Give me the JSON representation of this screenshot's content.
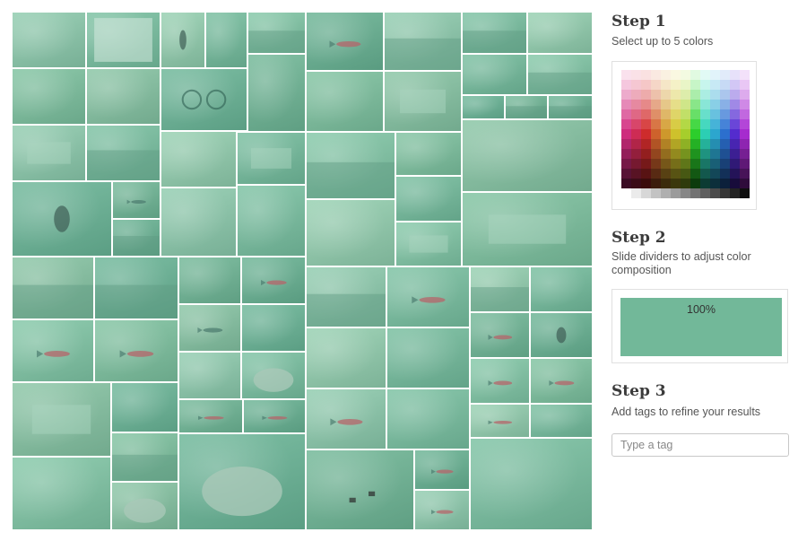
{
  "colors": {
    "water": [
      "#7ec3a4",
      "#86c9a9",
      "#6fb89a",
      "#92cdb0",
      "#79bfa0",
      "#8bc6a6",
      "#6db596",
      "#98d1b2",
      "#82c4a2",
      "#74b999"
    ],
    "selected_color": "#72b899"
  },
  "steps": [
    {
      "title": "Step 1",
      "description": "Select up to 5 colors"
    },
    {
      "title": "Step 2",
      "description": "Slide dividers to adjust color composition"
    },
    {
      "title": "Step 3",
      "description": "Add tags to refine your results"
    }
  ],
  "composition": {
    "percent_label": "100%"
  },
  "tag_input": {
    "placeholder": "Type a tag",
    "value": ""
  },
  "photo_subjects": [
    "underwater",
    "document-sheet",
    "diver",
    "underwater",
    "reef",
    "underwater",
    "sandy-bottom",
    "instrument-dials",
    "underwater",
    "fish",
    "seagrass",
    "coral",
    "underwater",
    "underwater",
    "reef",
    "underwater",
    "wreck",
    "sandy-bottom",
    "coral",
    "reef",
    "wreck",
    "coral",
    "underwater",
    "wreck",
    "seagrass",
    "underwater",
    "underwater",
    "swimmer",
    "shark",
    "reef",
    "underwater",
    "sandy-bottom",
    "underwater",
    "underwater",
    "wreck",
    "wreck",
    "seagrass",
    "reef",
    "sandy-bottom",
    "fish",
    "coral",
    "fish",
    "reef",
    "underwater",
    "fish",
    "fish",
    "shark",
    "sandy-bottom",
    "fish",
    "diver",
    "underwater",
    "stingray",
    "sandy-bottom",
    "underwater",
    "fish",
    "fish",
    "wreck",
    "underwater",
    "fish",
    "fish",
    "fish",
    "underwater",
    "fish",
    "sandy-bottom",
    "underwater",
    "seagrass",
    "stingray",
    "stingray",
    "starfish",
    "fish",
    "fish",
    "sandy-bottom",
    "underwater",
    "underwater",
    "fish"
  ]
}
